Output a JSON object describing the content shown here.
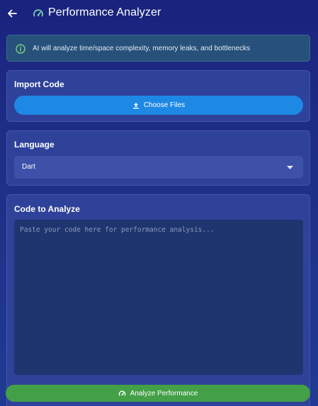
{
  "appbar": {
    "title": "Performance Analyzer",
    "back_icon": "arrow-left-icon",
    "title_icon": "speedometer-icon"
  },
  "info_banner": {
    "icon": "info-icon",
    "text": "AI will analyze time/space complexity, memory leaks, and bottlenecks"
  },
  "import_card": {
    "title": "Import Code",
    "button_label": "Choose Files",
    "button_icon": "upload-icon"
  },
  "language_card": {
    "title": "Language",
    "selected": "Dart",
    "dropdown_icon": "caret-down-icon"
  },
  "code_card": {
    "title": "Code to Analyze",
    "value": "",
    "placeholder": "Paste your code here for performance analysis..."
  },
  "analyze_button": {
    "label": "Analyze Performance",
    "icon": "speedometer-icon"
  },
  "colors": {
    "background_top": "#1a237e",
    "card": "#2f4299",
    "primary_button": "#1e88e5",
    "success_button": "#43a047",
    "info_banner": "#27507a",
    "title_icon": "#7fd8a8"
  }
}
